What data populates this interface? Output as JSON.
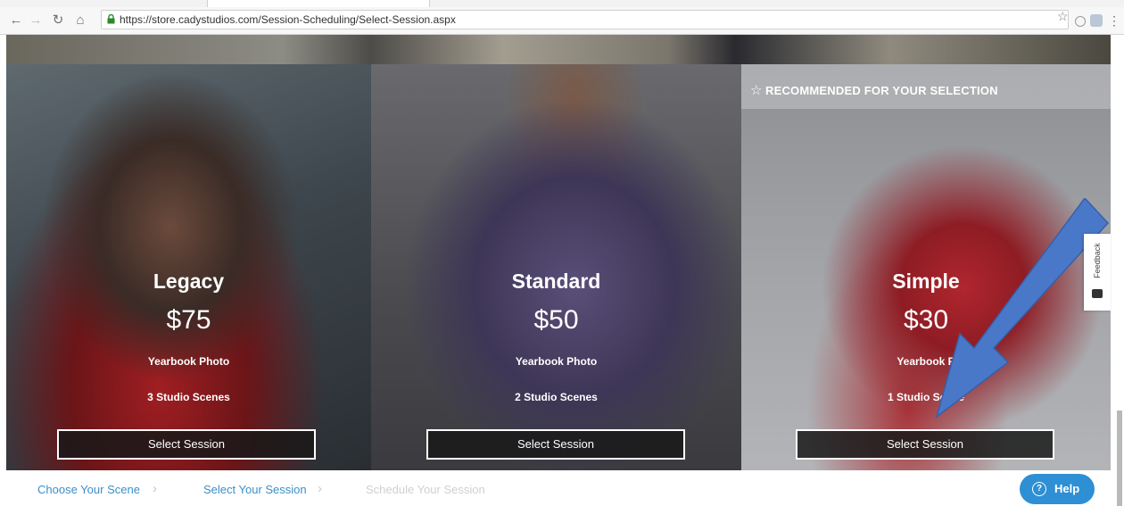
{
  "browser": {
    "url": "https://store.cadystudios.com/Session-Scheduling/Select-Session.aspx"
  },
  "cards": [
    {
      "name": "Legacy",
      "price": "$75",
      "feature1": "Yearbook Photo",
      "feature2": "3 Studio Scenes",
      "button": "Select Session"
    },
    {
      "name": "Standard",
      "price": "$50",
      "feature1": "Yearbook Photo",
      "feature2": "2 Studio Scenes",
      "button": "Select Session"
    },
    {
      "name": "Simple",
      "price": "$30",
      "feature1": "Yearbook P",
      "feature2": "1 Studio Scene",
      "button": "Select Session",
      "banner": "RECOMMENDED FOR YOUR SELECTION"
    }
  ],
  "feedback": {
    "label": "Feedback"
  },
  "breadcrumb": [
    {
      "label": "Choose Your Scene",
      "color": "#3a8fc9"
    },
    {
      "label": "Select Your Session",
      "color": "#3a8fc9"
    },
    {
      "label": "Schedule Your Session",
      "color": "#d0d0d0"
    }
  ],
  "help": {
    "label": "Help"
  },
  "colors": {
    "accent": "#2e8fd4",
    "arrow": "#4a78c9"
  }
}
